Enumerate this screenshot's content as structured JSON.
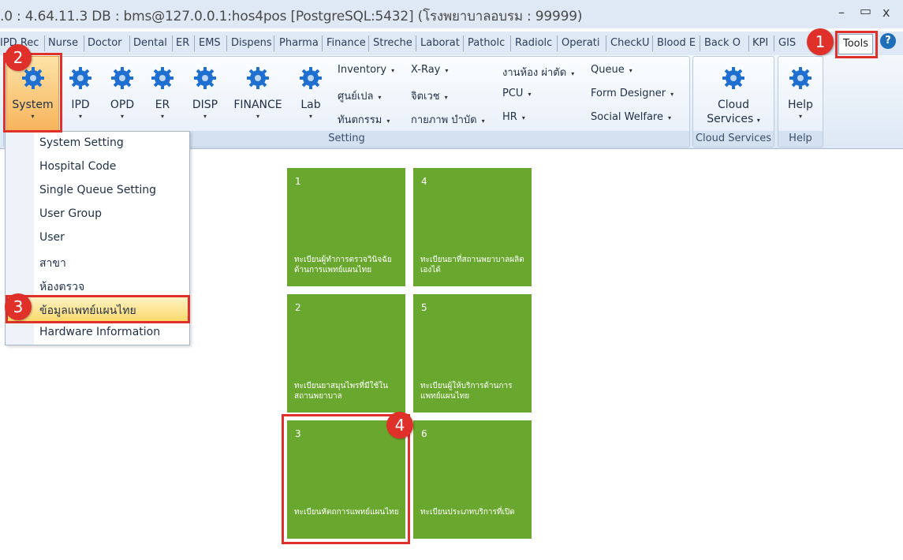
{
  "window": {
    "title": ".0 : 4.64.11.3 DB : bms@127.0.0.1:hos4pos [PostgreSQL:5432] (โรงพยาบาลอบรม : 99999)",
    "minimize": "–",
    "maximize": "▭",
    "close": "x"
  },
  "tabs": [
    "IPD Rec",
    "Nurse",
    "Doctor",
    "Dental",
    "ER",
    "EMS",
    "Dispens",
    "Pharma",
    "Finance",
    "Streche",
    "Laborat",
    "Patholc",
    "Radiolc",
    "Operati",
    "CheckU",
    "Blood E",
    "Back O",
    "KPI",
    "GIS"
  ],
  "tools_tab": "Tools",
  "help_glyph": "?",
  "ribbon": {
    "buttons": [
      {
        "label": "System"
      },
      {
        "label": "IPD"
      },
      {
        "label": "OPD"
      },
      {
        "label": "ER"
      },
      {
        "label": "DISP"
      },
      {
        "label": "FINANCE"
      },
      {
        "label": "Lab"
      }
    ],
    "col1": [
      "Inventory",
      "ศูนย์เปล",
      "ทันตกรรม"
    ],
    "col2": [
      "X-Ray",
      "จิตเวช",
      "กายภาพ บำบัด"
    ],
    "col3": [
      "งานห้อง ผ่าตัด",
      "PCU",
      "HR"
    ],
    "col4": [
      "Queue",
      "Form Designer",
      "Social Welfare"
    ],
    "group_setting": "Setting",
    "cloud_btn_line1": "Cloud",
    "cloud_btn_line2": "Services",
    "group_cloud": "Cloud Services",
    "help_btn": "Help",
    "group_help": "Help",
    "arrow": "▾"
  },
  "menu": {
    "items": [
      "System Setting",
      "Hospital Code",
      "Single Queue Setting",
      "User Group",
      "User",
      "สาขา",
      "ห้องตรวจ",
      "ข้อมูลแพทย์แผนไทย",
      "Hardware Information"
    ]
  },
  "tiles": [
    {
      "num": "1",
      "text": "ทะเบียนผู้ทำการตรวจวินิจฉัยด้านการแพทย์แผนไทย"
    },
    {
      "num": "4",
      "text": "ทะเบียนยาที่สถานพยาบาลผลิตเองได้"
    },
    {
      "num": "2",
      "text": "ทะเบียนยาสมุนไพรที่มีใช้ในสถานพยาบาล"
    },
    {
      "num": "5",
      "text": "ทะเบียนผู้ให้บริการด้านการแพทย์แผนไทย"
    },
    {
      "num": "3",
      "text": "ทะเบียนหัตถการแพทย์แผนไทย"
    },
    {
      "num": "6",
      "text": "ทะเบียนประเภทบริการที่เปิด"
    }
  ],
  "markers": [
    "1",
    "2",
    "3",
    "4"
  ],
  "colors": {
    "tile": "#6aa72e",
    "annotation": "#e0302a",
    "gear": "#1e6fd0",
    "highlight": "#fbd96c"
  }
}
